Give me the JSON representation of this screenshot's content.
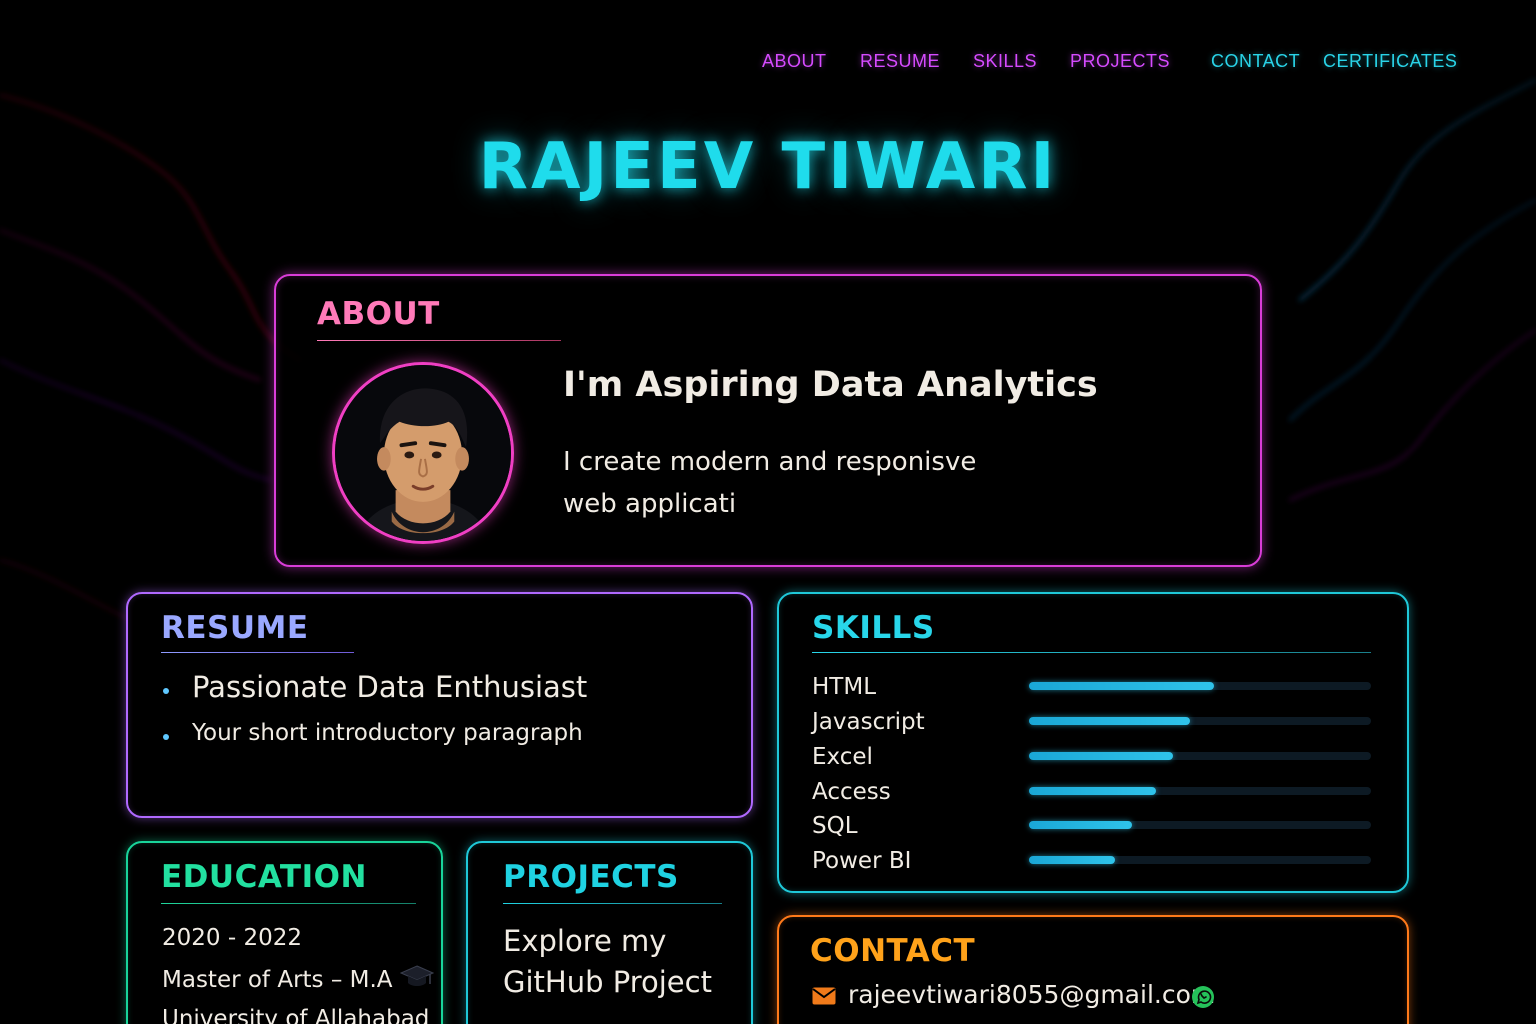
{
  "nav": {
    "items": [
      {
        "label": "ABOUT",
        "color": "#d64bff"
      },
      {
        "label": "RESUME",
        "color": "#d64bff"
      },
      {
        "label": "SKILLS",
        "color": "#d64bff"
      },
      {
        "label": "PROJECTS",
        "color": "#d64bff"
      },
      {
        "label": "CONTACT",
        "color": "#29d4e8"
      },
      {
        "label": "CERTIFICATES",
        "color": "#29d4e8"
      }
    ]
  },
  "hero": {
    "name": "RAJEEV TIWARI"
  },
  "about": {
    "title": "ABOUT",
    "avatar_icon": "avatar-illustration",
    "heading": "I'm Aspiring Data Analytics",
    "text": "I create modern and responisve web applicati"
  },
  "resume": {
    "title": "RESUME",
    "items": [
      "Passionate Data Enthusiast",
      "Your short introductory paragraph"
    ]
  },
  "education": {
    "title": "EDUCATION",
    "years": "2020 - 2022",
    "degree": "Master of Arts – M.A",
    "degree_icon": "graduation-cap-icon",
    "university": "University of Allahabad"
  },
  "projects": {
    "title": "PROJECTS",
    "text": "Explore my GitHub  Project"
  },
  "skills": {
    "title": "SKILLS",
    "items": [
      {
        "name": "HTML",
        "level": 0.54
      },
      {
        "name": "Javascript",
        "level": 0.47
      },
      {
        "name": "Excel",
        "level": 0.42
      },
      {
        "name": "Access",
        "level": 0.37
      },
      {
        "name": "SQL",
        "level": 0.3
      },
      {
        "name": "Power BI",
        "level": 0.25
      }
    ]
  },
  "contact": {
    "title": "CONTACT",
    "email": "rajeevtiwari8055@gmail.com",
    "email_icon": "mail-icon",
    "chat_icon": "whatsapp-icon"
  },
  "colors": {
    "accent_cyan": "#1fdcec",
    "accent_pink": "#d93dd8",
    "accent_purple": "#b069ff",
    "accent_green": "#19d49a",
    "accent_orange": "#ff7a1a"
  }
}
